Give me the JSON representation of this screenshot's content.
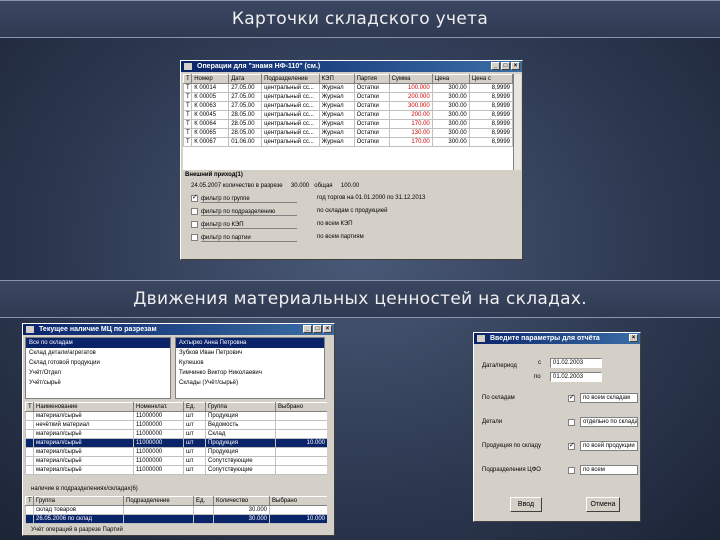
{
  "slides": {
    "title1": "Карточки складского учета",
    "title2": "Движения материальных ценностей на складах."
  },
  "win1": {
    "caption": "Операции для \"знамя НФ-110\" (см.)",
    "headers": [
      "Т",
      "Номер",
      "Дата",
      "Подразделение",
      "КЭП",
      "Партия",
      "Сумма",
      "Цена",
      "Цена с"
    ],
    "rows": [
      [
        "Т",
        "К 00014",
        "27.05.00",
        "центральный сс...",
        "Журнал",
        "Остатки",
        "100.000",
        "300.00",
        "8,9999"
      ],
      [
        "Т",
        "К 00005",
        "27.05.00",
        "центральный сс...",
        "Журнал",
        "Остатки",
        "200.000",
        "300.00",
        "8,9999"
      ],
      [
        "Т",
        "К 00063",
        "27.05.00",
        "центральный сс...",
        "Журнал",
        "Остатки",
        "300.000",
        "300.00",
        "8,9999"
      ],
      [
        "Т",
        "К 00045",
        "28.05.00",
        "центральный сс...",
        "Журнал",
        "Остатки",
        "200.00",
        "300.00",
        "8,9999"
      ],
      [
        "Т",
        "К 00064",
        "28.05.00",
        "центральный сс...",
        "Журнал",
        "Остатки",
        "170.00",
        "300.00",
        "8,9999"
      ],
      [
        "Т",
        "К 00065",
        "28.05.00",
        "центральный сс...",
        "Журнал",
        "Остатки",
        "130.00",
        "300.00",
        "8,9999"
      ],
      [
        "Т",
        "К 00067",
        "01.06.00",
        "центральный сс...",
        "Журнал",
        "Остатки",
        "170.00",
        "300.00",
        "8,9999"
      ]
    ],
    "section": "Внешний приход(1)",
    "summary": "24.05.2007 количество в разрезе     30.000   общая     100.00",
    "filters": [
      {
        "label": "фильтр по группе",
        "right": "год торгов на 01.01.2000 по 31.12.2013",
        "checked": true
      },
      {
        "label": "фильтр по подразделению",
        "right": "по складам с продукцией",
        "checked": false
      },
      {
        "label": "фильтр по КЭП",
        "right": "по всем КЭП",
        "checked": false
      },
      {
        "label": "фильтр по партии",
        "right": "по всем партиям",
        "checked": false
      }
    ]
  },
  "win2": {
    "caption": "Текущее наличие МЦ по разрезам",
    "list_left": [
      "Все по складам",
      "Склад детали/агрегатов",
      "Склад готовой продукции",
      "Учёт/Отдел",
      "Учёт/сырьё"
    ],
    "list_right": [
      "Ахтырко Анна Петровна",
      "Зубков Иван Петрович",
      "Кулешов",
      "Тимчинко Виктор Николаевич",
      "Склады (Учёт/сырьё)"
    ],
    "headers": [
      "Т",
      "Наименование",
      "Номенклат.",
      "Ед.",
      "Группа",
      "Выбрано"
    ],
    "rows": [
      [
        "",
        "материал/сырьё",
        "11000000",
        "шт",
        "Продукция",
        ""
      ],
      [
        "",
        "нечёткий материал",
        "11000000",
        "шт",
        "Ведомость",
        ""
      ],
      [
        "",
        "материал/сырьё",
        "11000000",
        "шт",
        "Склад",
        ""
      ],
      [
        "",
        "материал/сырьё",
        "11000000",
        "шт",
        "Продукция",
        "10.000"
      ],
      [
        "",
        "материал/сырьё",
        "11000000",
        "шт",
        "Продукция",
        ""
      ],
      [
        "",
        "материал/сырьё",
        "11000000",
        "шт",
        "Сопутствующие",
        ""
      ],
      [
        "",
        "материал/сырьё",
        "11000000",
        "шт",
        "Сопутствующие",
        ""
      ]
    ],
    "sub_label": "наличие в подразделениях/складах(6)",
    "sub_headers": [
      "Т",
      "Группа",
      "Подразделение",
      "Ед.",
      "Количество",
      "Выбрано"
    ],
    "sub_rows": [
      [
        "",
        "склад товаров",
        "",
        "",
        "30.000",
        ""
      ],
      [
        "",
        "26.05.2006 по склад",
        "",
        "",
        "30.000",
        "10.000"
      ]
    ],
    "footer": "Учёт операций в разрезе Партий"
  },
  "win3": {
    "caption": "Введите параметры для отчёта",
    "period_label": "Дата/период",
    "from_label": "с",
    "to_label": "по",
    "from_value": "01.02.2003",
    "to_value": "01.02.2003",
    "rows": [
      {
        "label": "По складам",
        "value": "по всем складам",
        "checked": true
      },
      {
        "label": "Детали",
        "value": "отдельно по складам",
        "checked": false
      },
      {
        "label": "Продукция по складу",
        "value": "по всей продукции",
        "checked": true
      },
      {
        "label": "Подразделения ЦФО",
        "value": "по всем",
        "checked": false
      }
    ],
    "ok": "Ввод",
    "cancel": "Отмена"
  }
}
